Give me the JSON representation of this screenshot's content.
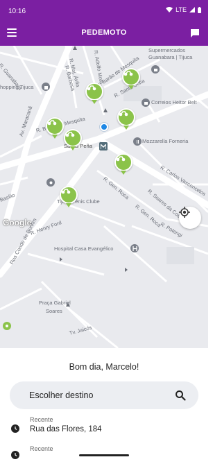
{
  "status_bar": {
    "time": "10:16",
    "network": "LTE"
  },
  "app_bar": {
    "title": "PEDEMOTO",
    "menu_icon": "menu-icon",
    "chat_icon": "chat-icon"
  },
  "colors": {
    "primary": "#7b1fa2",
    "driver_pin": "#8bc34a",
    "user_dot": "#1e88e5"
  },
  "map": {
    "provider_logo": "Google",
    "labels": {
      "supermercados": "Supermercados",
      "guanabara": "Guanabara | Tijuca",
      "shopping": "hopping Tijuca",
      "correios": "Correios Heitor Belt",
      "mozzarella": "Mozzarella Forneria",
      "saens_pena": "Saens Peña",
      "tijuca_tenis": "Tijuca Tênis Clube",
      "hospital": "Hospital Casa Evangélico",
      "praca_gabriel": "Praça Gabriel",
      "soares": "Soares",
      "street_guanabara": "R. Guanabara",
      "street_maj_avila": "R. Maj. Ávila",
      "street_barbosa": "R. Barbosa",
      "street_adolfo_mota": "R. Adolfo Mota",
      "street_barao_mesquita_top": "R. Barão de Mesquita",
      "street_santa_sofia": "R. Santa Sofia",
      "street_barao_mesquita_mid": "R. Barão de Mesquita",
      "street_maracana": "Av. Maracanã",
      "street_basilio": "Basílio",
      "street_gen_roca_1": "R. Gen. Roca",
      "street_gen_roca_2": "R. Gen. Roca",
      "street_carlos_vasconcelos": "R. Carlos Vasconcelos",
      "street_soares_costa": "R. Soares da Costa",
      "street_conde_bonfim": "Rua Conde de Bonfim",
      "street_henry_ford": "R. Henry Ford",
      "street_potengi": "R. Potengi",
      "street_jaicos": "Tv. Jaicós"
    }
  },
  "sheet": {
    "greeting": "Bom dia, Marcelo!",
    "search": {
      "label": "Escolher destino",
      "icon": "search-icon"
    },
    "recents": [
      {
        "kicker": "Recente",
        "address": "Rua das Flores, 184",
        "icon": "clock-icon"
      },
      {
        "kicker": "Recente",
        "address": "",
        "icon": "clock-icon"
      }
    ]
  }
}
